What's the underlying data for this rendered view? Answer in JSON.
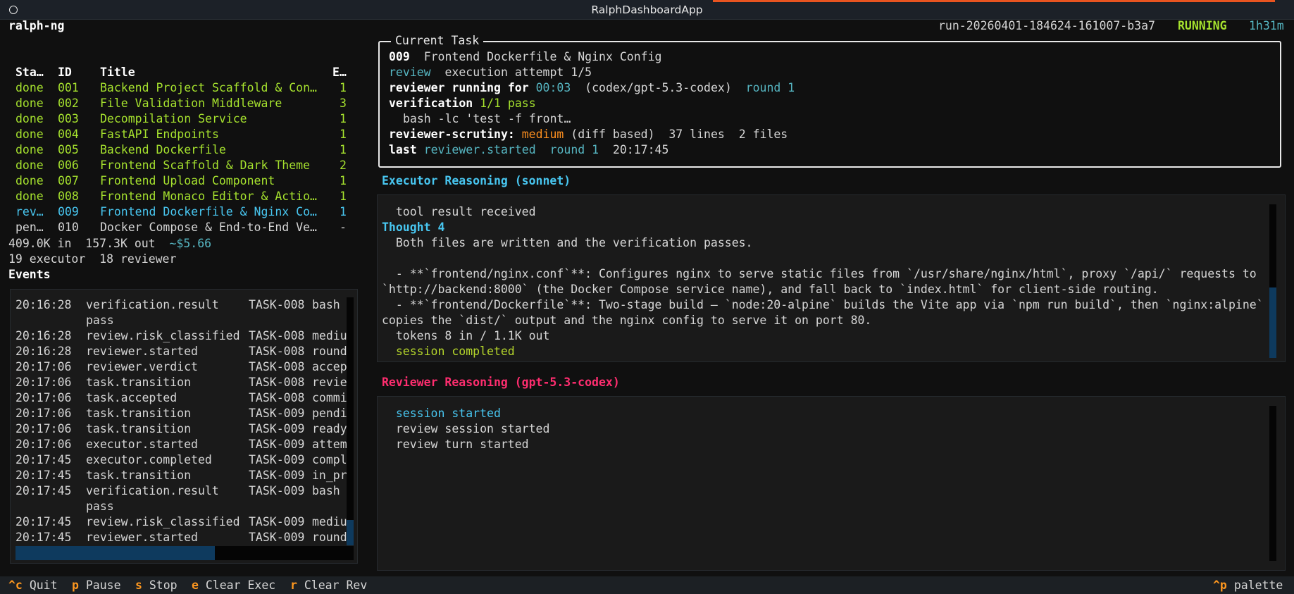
{
  "window": {
    "title": "RalphDashboardApp"
  },
  "header": {
    "app_name": "ralph-ng",
    "run_id": "run-20260401-184624-161007-b3a7",
    "status": "RUNNING",
    "elapsed": "1h31m"
  },
  "task_table": {
    "columns": [
      "Sta…",
      "ID",
      "Title",
      "E…"
    ],
    "rows": [
      {
        "status": "done",
        "id": "001",
        "title": "Backend Project Scaffold & Con…",
        "e": "1",
        "state": "done"
      },
      {
        "status": "done",
        "id": "002",
        "title": "File Validation Middleware",
        "e": "3",
        "state": "done"
      },
      {
        "status": "done",
        "id": "003",
        "title": "Decompilation Service",
        "e": "1",
        "state": "done"
      },
      {
        "status": "done",
        "id": "004",
        "title": "FastAPI Endpoints",
        "e": "1",
        "state": "done"
      },
      {
        "status": "done",
        "id": "005",
        "title": "Backend Dockerfile",
        "e": "1",
        "state": "done"
      },
      {
        "status": "done",
        "id": "006",
        "title": "Frontend Scaffold & Dark Theme",
        "e": "2",
        "state": "done"
      },
      {
        "status": "done",
        "id": "007",
        "title": "Frontend Upload Component",
        "e": "1",
        "state": "done"
      },
      {
        "status": "done",
        "id": "008",
        "title": "Frontend Monaco Editor & Actio…",
        "e": "1",
        "state": "done"
      },
      {
        "status": "rev…",
        "id": "009",
        "title": "Frontend Dockerfile & Nginx Co…",
        "e": "1",
        "state": "review"
      },
      {
        "status": "pen…",
        "id": "010",
        "title": "Docker Compose & End-to-End Ve…",
        "e": "-",
        "state": "pending"
      }
    ]
  },
  "stats": {
    "tokens_in": "409.0K in",
    "tokens_out": "157.3K out",
    "cost": "~$5.66",
    "executor_count": "19 executor",
    "reviewer_count": "18 reviewer"
  },
  "events": {
    "title": "Events",
    "rows": [
      {
        "time": "20:16:28",
        "type": "verification.result",
        "task": "TASK-008",
        "detail": "bash"
      },
      {
        "time": "",
        "type": "pass",
        "task": "",
        "detail": ""
      },
      {
        "time": "20:16:28",
        "type": "review.risk_classified",
        "task": "TASK-008",
        "detail": "mediu"
      },
      {
        "time": "20:16:28",
        "type": "reviewer.started",
        "task": "TASK-008",
        "detail": "round"
      },
      {
        "time": "20:17:06",
        "type": "reviewer.verdict",
        "task": "TASK-008",
        "detail": "accep"
      },
      {
        "time": "20:17:06",
        "type": "task.transition",
        "task": "TASK-008",
        "detail": "revie"
      },
      {
        "time": "20:17:06",
        "type": "task.accepted",
        "task": "TASK-008",
        "detail": "commi"
      },
      {
        "time": "20:17:06",
        "type": "task.transition",
        "task": "TASK-009",
        "detail": "pendi"
      },
      {
        "time": "20:17:06",
        "type": "task.transition",
        "task": "TASK-009",
        "detail": "ready"
      },
      {
        "time": "20:17:06",
        "type": "executor.started",
        "task": "TASK-009",
        "detail": "attem"
      },
      {
        "time": "20:17:45",
        "type": "executor.completed",
        "task": "TASK-009",
        "detail": "compl"
      },
      {
        "time": "20:17:45",
        "type": "task.transition",
        "task": "TASK-009",
        "detail": "in_pr"
      },
      {
        "time": "20:17:45",
        "type": "verification.result",
        "task": "TASK-009",
        "detail": "bash"
      },
      {
        "time": "",
        "type": "pass",
        "task": "",
        "detail": ""
      },
      {
        "time": "20:17:45",
        "type": "review.risk_classified",
        "task": "TASK-009",
        "detail": "mediu"
      },
      {
        "time": "20:17:45",
        "type": "reviewer.started",
        "task": "TASK-009",
        "detail": "round"
      }
    ]
  },
  "current_task": {
    "panel_title": "Current Task",
    "id": "009",
    "title": "Frontend Dockerfile & Nginx Config",
    "phase": "review",
    "attempt": "execution attempt 1/5",
    "reviewer_label": "reviewer running for",
    "reviewer_time": "00:03",
    "reviewer_model": "(codex/gpt-5.3-codex)",
    "reviewer_round": "round 1",
    "verification_label": "verification",
    "verification_value": "1/1 pass",
    "verification_cmd": "bash -lc 'test -f front…",
    "scrutiny_label": "reviewer-scrutiny:",
    "scrutiny_level": "medium",
    "scrutiny_rest": "(diff based)  37 lines  2 files",
    "last_label": "last",
    "last_event": "reviewer.started",
    "last_round": "round 1",
    "last_time": "20:17:45"
  },
  "executor_panel": {
    "title": "Executor Reasoning (sonnet)",
    "lines": {
      "l1": "  tool result received",
      "l2": "Thought 4",
      "l3": "  Both files are written and the verification passes.",
      "l4": "  - **`frontend/nginx.conf`**: Configures nginx to serve static files from `/usr/share/nginx/html`, proxy `/api/` requests to",
      "l5": "`http://backend:8000` (the Docker Compose service name), and fall back to `index.html` for client-side routing.",
      "l6": "  - **`frontend/Dockerfile`**: Two-stage build — `node:20-alpine` builds the Vite app via `npm run build`, then `nginx:alpine`",
      "l7": "copies the `dist/` output and the nginx config to serve it on port 80.",
      "l8": "  tokens 8 in / 1.1K out",
      "l9": "  session completed"
    }
  },
  "reviewer_panel": {
    "title": "Reviewer Reasoning (gpt-5.3-codex)",
    "lines": {
      "l1": "  session started",
      "l2": "  review session started",
      "l3": "  review turn started"
    }
  },
  "footer": {
    "quit_key": "^c",
    "quit_label": "Quit",
    "pause_key": "p",
    "pause_label": "Pause",
    "stop_key": "s",
    "stop_label": "Stop",
    "clear_exec_key": "e",
    "clear_exec_label": "Clear Exec",
    "clear_rev_key": "r",
    "clear_rev_label": "Clear Rev",
    "palette_key": "^p",
    "palette_label": "palette"
  },
  "colors": {
    "done": "#a6e22e",
    "review": "#48c6f0",
    "running": "#a6e22e",
    "accent_key": "#fd971f",
    "reviewer_title": "#ff2d6f",
    "executor_title": "#48c6f0"
  }
}
